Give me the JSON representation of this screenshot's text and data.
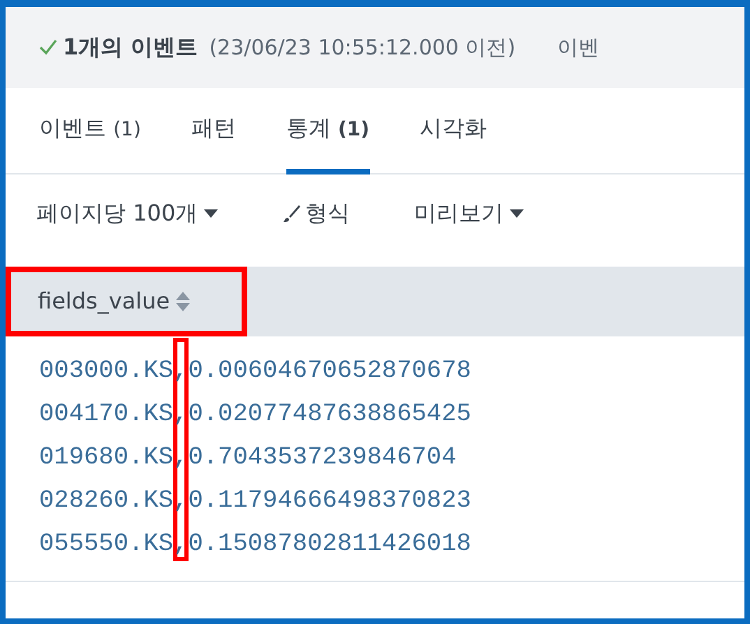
{
  "header": {
    "status_ok": true,
    "title": "1개의 이벤트",
    "subtitle": "(23/06/23 10:55:12.000 이전)",
    "cut_label": "이벤"
  },
  "tabs": [
    {
      "label": "이벤트",
      "count": "(1)",
      "selected": false
    },
    {
      "label": "패턴",
      "selected": false
    },
    {
      "label": "통계",
      "count": "(1)",
      "selected": true
    },
    {
      "label": "시각화",
      "selected": false
    }
  ],
  "toolbar": [
    {
      "kind": "dropdown",
      "label": "페이지당 100개"
    },
    {
      "kind": "brush",
      "label": "형식"
    },
    {
      "kind": "dropdown",
      "label": "미리보기"
    }
  ],
  "table": {
    "columns": [
      {
        "label": "fields_value",
        "highlighted": true
      }
    ],
    "separator_highlighted": true,
    "rows": [
      "003000.KS,0.00604670652870678",
      "004170.KS,0.02077487638865425",
      "019680.KS,0.7043537239846704",
      "028260.KS,0.11794666498370823",
      "055550.KS,0.15087802811426018"
    ]
  }
}
